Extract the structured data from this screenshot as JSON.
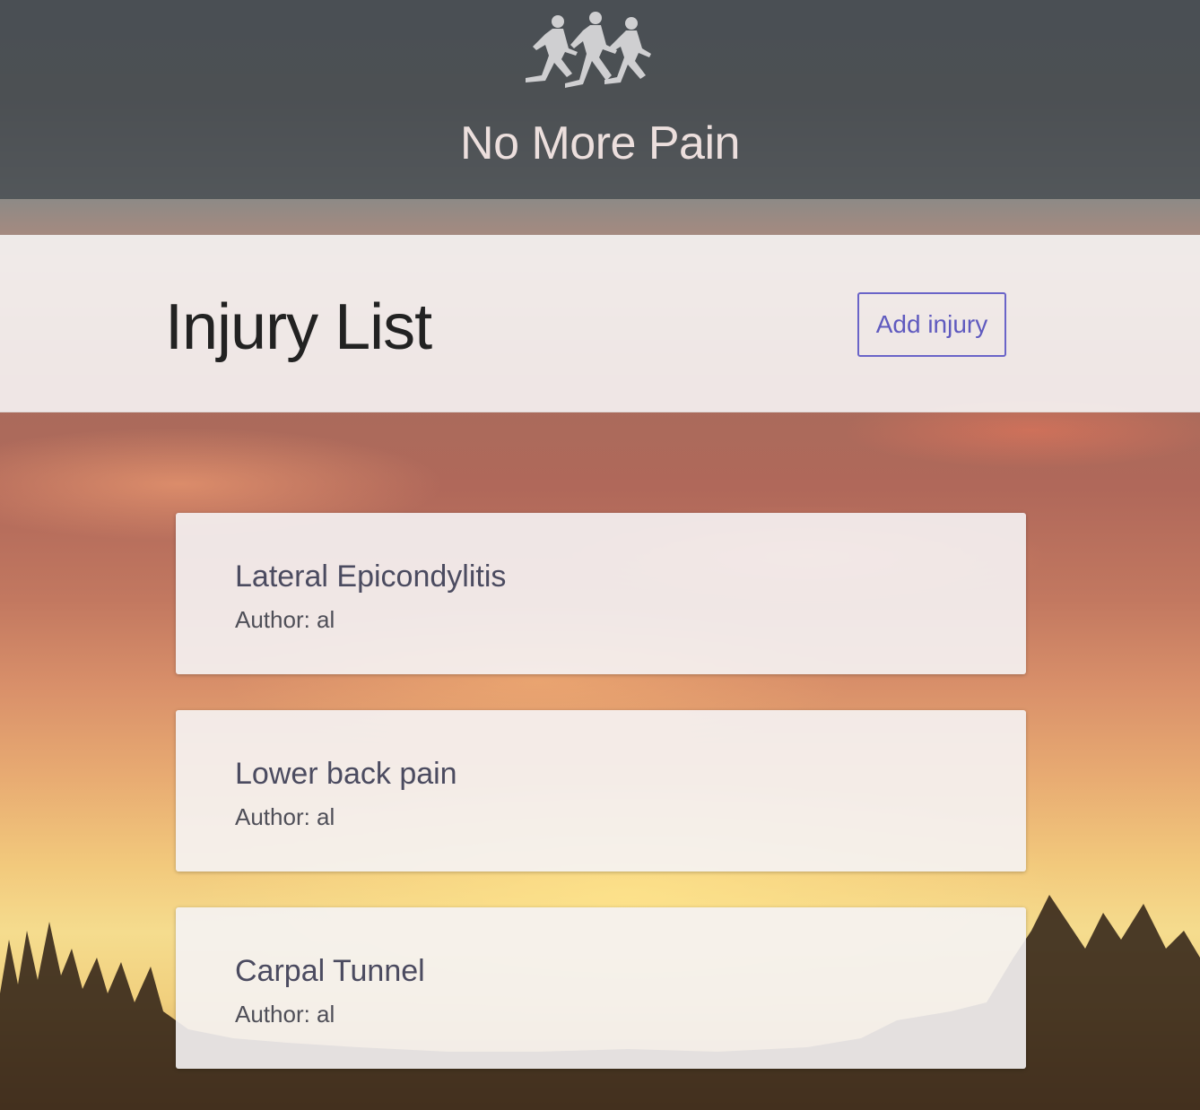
{
  "header": {
    "logo_icon": "runners-icon",
    "site_title": "No More Pain"
  },
  "page": {
    "title": "Injury List",
    "add_button_label": "Add injury"
  },
  "injuries": [
    {
      "name": "Lateral Epicondylitis",
      "author": "Author: al"
    },
    {
      "name": "Lower back pain",
      "author": "Author: al"
    },
    {
      "name": "Carpal Tunnel",
      "author": "Author: al"
    }
  ],
  "colors": {
    "header_overlay": "#464c50",
    "accent": "#6a64c8",
    "title_text": "#222222"
  }
}
